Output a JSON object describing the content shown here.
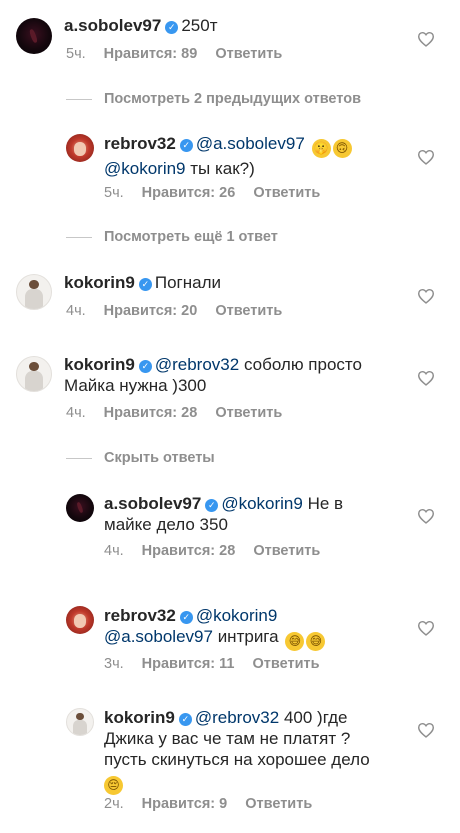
{
  "comments": [
    {
      "username": "a.sobolev97",
      "text": "250т",
      "time": "5ч.",
      "likes": "Нравится: 89",
      "reply": "Ответить"
    },
    {
      "username": "rebrov32",
      "mention1": "@a.sobolev97",
      "mention2": "@kokorin9",
      "text_after": "ты как?)",
      "time": "5ч.",
      "likes": "Нравится: 26",
      "reply": "Ответить"
    },
    {
      "username": "kokorin9",
      "text": "Погнали",
      "time": "4ч.",
      "likes": "Нравится: 20",
      "reply": "Ответить"
    },
    {
      "username": "kokorin9",
      "mention": "@rebrov32",
      "text_line1": "соболю просто",
      "text_line2": "Майка нужна )300",
      "time": "4ч.",
      "likes": "Нравится: 28",
      "reply": "Ответить"
    },
    {
      "username": "a.sobolev97",
      "mention": "@kokorin9",
      "text_line1": "Не в",
      "text_line2": "майке дело 350",
      "time": "4ч.",
      "likes": "Нравится: 28",
      "reply": "Ответить"
    },
    {
      "username": "rebrov32",
      "mention1": "@kokorin9",
      "mention2": "@a.sobolev97",
      "text_after": "интрига",
      "time": "3ч.",
      "likes": "Нравится: 11",
      "reply": "Ответить"
    },
    {
      "username": "kokorin9",
      "mention": "@rebrov32",
      "text_line1": "400 )где",
      "text_line2": "Джика у вас че там не платят ?",
      "text_line3": "пусть скинуться на хорошее дело",
      "time": "2ч.",
      "likes": "Нравится: 9",
      "reply": "Ответить"
    }
  ],
  "threads": {
    "view_previous": "Посмотреть 2 предыдущих ответов",
    "view_more": "Посмотреть ещё 1 ответ",
    "hide": "Скрыть ответы"
  },
  "colors": {
    "text": "#262626",
    "mention": "#00376b",
    "meta": "#8e8e8e",
    "verified": "#3897f0"
  },
  "icons": {
    "like": "heart-outline-icon",
    "verified": "verified-badge-icon"
  }
}
